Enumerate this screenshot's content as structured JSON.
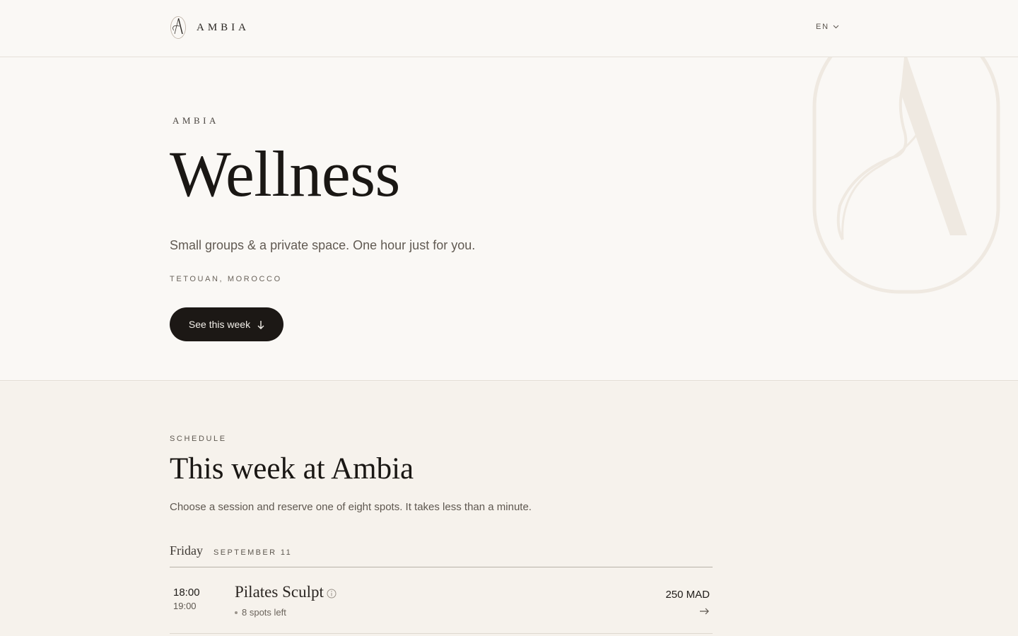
{
  "header": {
    "brand": "AMBIA",
    "language": "EN"
  },
  "hero": {
    "eyebrow": "AMBIA",
    "title": "Wellness",
    "subtitle": "Small groups & a private space. One hour just for you.",
    "location": "TETOUAN, MOROCCO",
    "cta_label": "See this week"
  },
  "schedule": {
    "eyebrow": "SCHEDULE",
    "title": "This week at Ambia",
    "subtitle": "Choose a session and reserve one of eight spots. It takes less than a minute.",
    "days": [
      {
        "day": "Friday",
        "date": "SEPTEMBER 11",
        "sessions": [
          {
            "start": "18:00",
            "end": "19:00",
            "name": "Pilates Sculpt",
            "availability": "8 spots left",
            "price": "250 MAD"
          }
        ]
      }
    ]
  },
  "icons": {
    "logo": "a-monogram-icon",
    "language": "chevron-down-icon",
    "cta": "arrow-down-icon",
    "session_info": "info-icon",
    "session_go": "arrow-right-icon"
  },
  "colors": {
    "background": "#faf8f5",
    "section_background": "#f6f2ec",
    "text": "#1a1714",
    "button": "#1c1815",
    "button_text": "#f4f0ea",
    "watermark": "#efe9e1"
  }
}
